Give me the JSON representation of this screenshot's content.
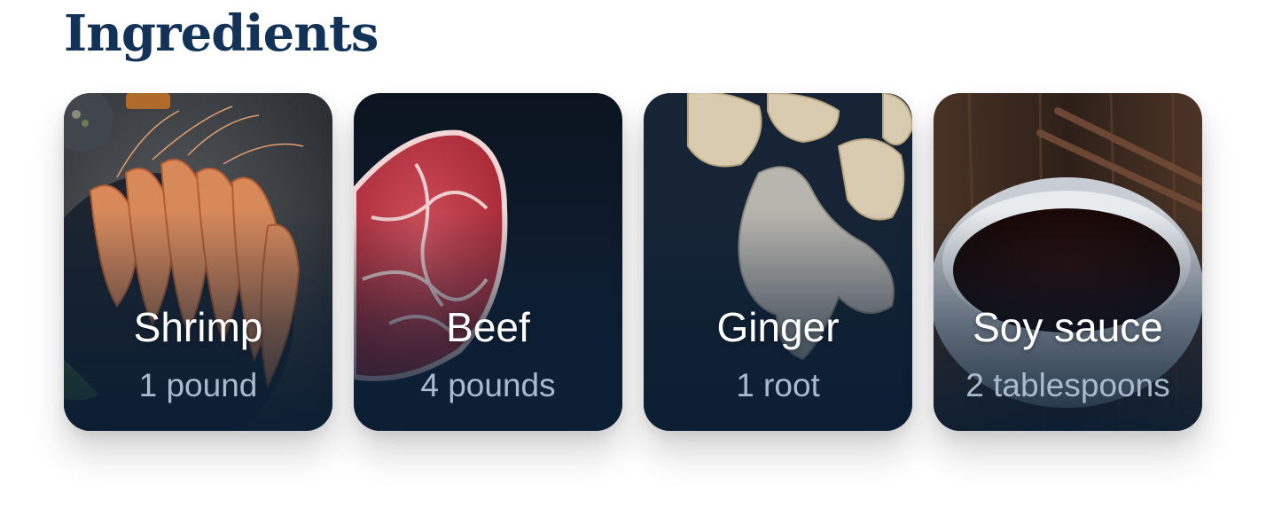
{
  "section": {
    "title": "Ingredients"
  },
  "ingredients": [
    {
      "name": "Shrimp",
      "quantity": "1 pound",
      "image": "shrimp-photo"
    },
    {
      "name": "Beef",
      "quantity": "4 pounds",
      "image": "beef-photo"
    },
    {
      "name": "Ginger",
      "quantity": "1 root",
      "image": "ginger-photo"
    },
    {
      "name": "Soy sauce",
      "quantity": "2 tablespoons",
      "image": "soy-sauce-photo"
    }
  ],
  "colors": {
    "heading": "#123257",
    "card_overlay": "#0b1e34",
    "quantity_text": "#a9bbcf",
    "name_text": "#ffffff"
  }
}
